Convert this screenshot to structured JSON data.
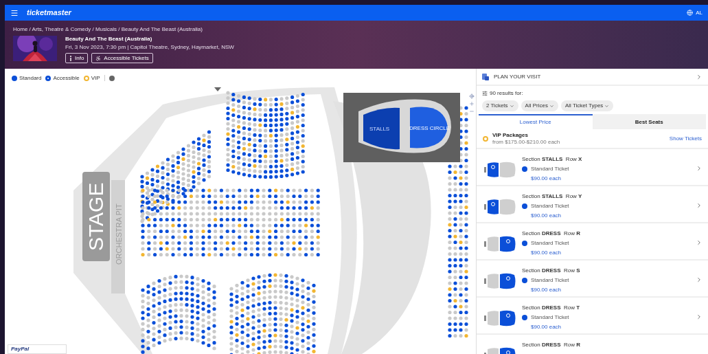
{
  "top_bar": {
    "logo": "ticketmaster",
    "locale": "AL"
  },
  "event": {
    "breadcrumb": "Home / Arts, Theatre & Comedy / Musicals / Beauty And The Beast (Australia)",
    "title": "Beauty And The Beast (Australia)",
    "details": "Fri, 3 Nov 2023, 7:30 pm | Capitol Theatre, Sydney, Haymarket, NSW",
    "buttons": [
      {
        "kind": "info",
        "label": "Info"
      },
      {
        "kind": "accessible",
        "label": "Accessible Tickets"
      }
    ]
  },
  "legend": [
    {
      "kind": "standard",
      "label": "Standard",
      "color": "#0b4fd8"
    },
    {
      "kind": "accessible",
      "label": "Accessible",
      "color": "#0b4fd8"
    },
    {
      "kind": "vip",
      "label": "VIP",
      "color": "#f2b632"
    }
  ],
  "seat_map": {
    "stage": "STAGE",
    "pit": "ORCHESTRA PIT",
    "minimap_sections": [
      "STALLS",
      "DRESS CIRCLE"
    ]
  },
  "payment_badge": "PayPal",
  "panel": {
    "plan_visit": "PLAN YOUR VISIT",
    "results": "90 results for:",
    "filters": [
      "2 Tickets",
      "All Prices",
      "All Ticket Types"
    ],
    "tabs": [
      {
        "label": "Lowest Price",
        "selected": true
      },
      {
        "label": "Best Seats",
        "selected": false
      }
    ],
    "vip": {
      "title": "VIP Packages",
      "price_range": "from $175.00-$210.00 each",
      "action": "Show Tickets"
    },
    "listings": [
      {
        "section": "Section **STALLS**  Row **X**",
        "kind": "front",
        "ticket": "Standard Ticket",
        "price": "$90.00 each",
        "color": "#0b4fd8"
      },
      {
        "section": "Section **STALLS**  Row **Y**",
        "kind": "front",
        "ticket": "Standard Ticket",
        "price": "$90.00 each",
        "color": "#0b4fd8"
      },
      {
        "section": "Section **DRESS**  Row **R**",
        "kind": "back",
        "ticket": "Standard Ticket",
        "price": "$90.00 each",
        "color": "#0b4fd8"
      },
      {
        "section": "Section **DRESS**  Row **S**",
        "kind": "back",
        "ticket": "Standard Ticket",
        "price": "$90.00 each",
        "color": "#0b4fd8"
      },
      {
        "section": "Section **DRESS**  Row **T**",
        "kind": "back",
        "ticket": "Standard Ticket",
        "price": "$90.00 each",
        "color": "#0b4fd8"
      },
      {
        "section": "Section **DRESS**  Row **R**",
        "kind": "back"
      }
    ]
  }
}
